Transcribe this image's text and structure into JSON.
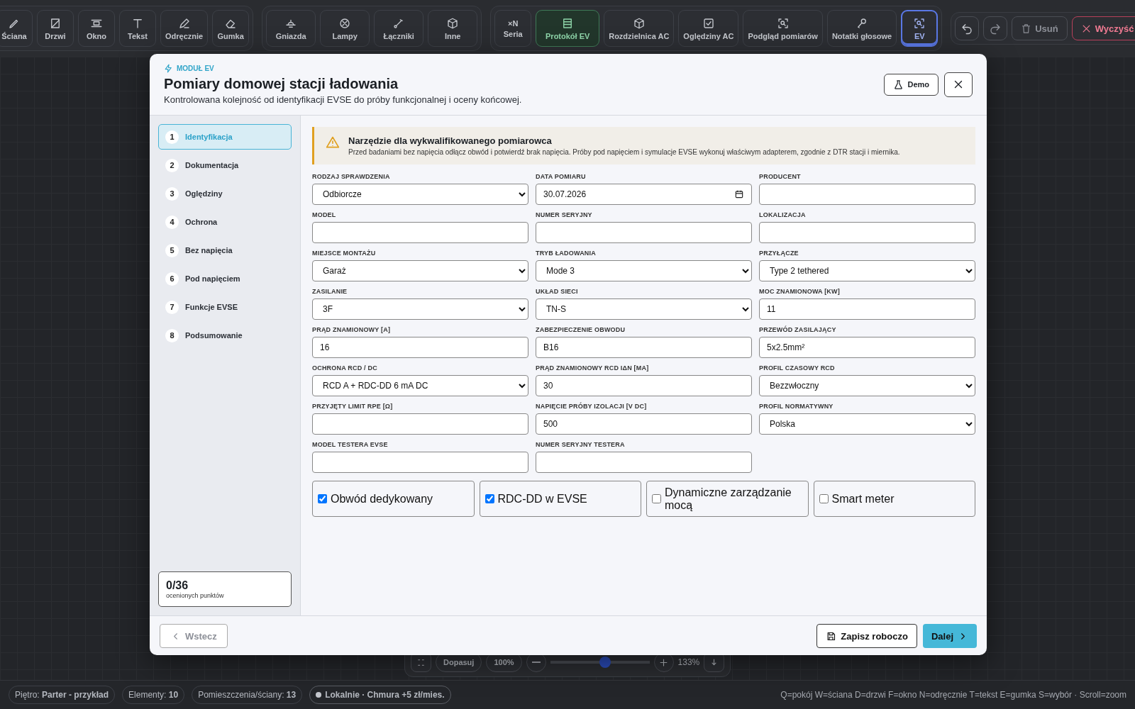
{
  "toolbar": {
    "groups": [
      {
        "buttons": [
          {
            "label": "Ściana"
          },
          {
            "label": "Drzwi"
          },
          {
            "label": "Okno"
          },
          {
            "label": "Tekst"
          },
          {
            "label": "Odręcznie"
          },
          {
            "label": "Gumka"
          }
        ]
      },
      {
        "buttons": [
          {
            "label": "Gniazda"
          },
          {
            "label": "Lampy"
          },
          {
            "label": "Łączniki"
          },
          {
            "label": "Inne"
          }
        ]
      },
      {
        "buttons": [
          {
            "label": "Seria",
            "badge": "×N",
            "selected": false,
            "highlighted": false
          },
          {
            "label": "Protokół EV",
            "selected": false,
            "highlighted": true
          },
          {
            "label": "Rozdzielnica AC",
            "selected": false,
            "highlighted": false
          },
          {
            "label": "Oględziny AC",
            "selected": false,
            "highlighted": false
          },
          {
            "label": "Podgląd pomiarów",
            "selected": false,
            "highlighted": false
          },
          {
            "label": "Notatki głosowe",
            "selected": false,
            "highlighted": false
          },
          {
            "label": "EV",
            "selected": true,
            "highlighted": false
          }
        ]
      }
    ],
    "undo": {
      "disabled": false
    },
    "redo": {
      "disabled": true
    },
    "delete": {
      "label": "Usuń",
      "disabled": true
    },
    "clear": {
      "label": "Wyczyść"
    }
  },
  "zoom_bar": {
    "fit": "Dopasuj",
    "preset": "100%",
    "level": 0.55,
    "reading": "133%"
  },
  "status_bar": {
    "items": [
      {
        "label": "Piętro:",
        "value": "Parter - przykład"
      },
      {
        "label": "Elementy:",
        "value": "10"
      },
      {
        "label": "Pomieszczenia/ściany:",
        "value": "13"
      }
    ],
    "storage": "Lokalnie · Chmura +5 zł/mies.",
    "shortcuts": "Q=pokój W=ściana D=drzwi F=okno N=odręcznie T=tekst E=gumka S=wybór · Scroll=zoom"
  },
  "dialog": {
    "module": "MODUŁ EV",
    "title": "Pomiary domowej stacji ładowania",
    "subtitle": "Kontrolowana kolejność od identyfikacji EVSE do próby funkcjonalnej i oceny końcowej.",
    "demo": "Demo",
    "steps": [
      {
        "number": "1",
        "label": "Identyfikacja",
        "selected": true
      },
      {
        "number": "2",
        "label": "Dokumentacja",
        "selected": false
      },
      {
        "number": "3",
        "label": "Oględziny",
        "selected": false
      },
      {
        "number": "4",
        "label": "Ochrona",
        "selected": false
      },
      {
        "number": "5",
        "label": "Bez napięcia",
        "selected": false
      },
      {
        "number": "6",
        "label": "Pod napięciem",
        "selected": false
      },
      {
        "number": "7",
        "label": "Funkcje EVSE",
        "selected": false
      },
      {
        "number": "8",
        "label": "Podsumowanie",
        "selected": false
      }
    ],
    "progress": {
      "count": "0/36",
      "caption": "ocenionych punktów"
    },
    "alert": {
      "title": "Narzędzie dla wykwalifikowanego pomiarowca",
      "text": "Przed badaniami bez napięcia odłącz obwód i potwierdź brak napięcia. Próby pod napięciem i symulacje EVSE wykonuj właściwym adapterem, zgodnie z DTR stacji i miernika."
    },
    "fields": [
      {
        "label": "RODZAJ SPRAWDZENIA",
        "kind": "select",
        "value": "Odbiorcze"
      },
      {
        "label": "DATA POMIARU",
        "kind": "date",
        "value": "30.07.2026"
      },
      {
        "label": "PRODUCENT",
        "kind": "input"
      },
      {
        "label": "MODEL",
        "kind": "input"
      },
      {
        "label": "NUMER SERYJNY",
        "kind": "input"
      },
      {
        "label": "LOKALIZACJA",
        "kind": "input"
      },
      {
        "label": "MIEJSCE MONTAŻU",
        "kind": "select",
        "value": "Garaż"
      },
      {
        "label": "TRYB ŁADOWANIA",
        "kind": "select",
        "value": "Mode 3"
      },
      {
        "label": "PRZYŁĄCZE",
        "kind": "select",
        "value": "Type 2 tethered"
      },
      {
        "label": "ZASILANIE",
        "kind": "select",
        "value": "3F"
      },
      {
        "label": "UKŁAD SIECI",
        "kind": "select",
        "value": "TN-S"
      },
      {
        "label": "MOC ZNAMIONOWA [KW]",
        "kind": "input",
        "value": "11"
      },
      {
        "label": "PRĄD ZNAMIONOWY [A]",
        "kind": "input",
        "value": "16"
      },
      {
        "label": "ZABEZPIECZENIE OBWODU",
        "kind": "input",
        "value": "B16"
      },
      {
        "label": "PRZEWÓD ZASILAJĄCY",
        "kind": "input",
        "value": "5x2.5mm²"
      },
      {
        "label": "OCHRONA RCD / DC",
        "kind": "select",
        "value": "RCD A + RDC-DD 6 mA DC"
      },
      {
        "label": "PRĄD ZNAMIONOWY RCD IΔN [MA]",
        "kind": "input",
        "value": "30"
      },
      {
        "label": "PROFIL CZASOWY RCD",
        "kind": "select",
        "value": "Bezzwłoczny"
      },
      {
        "label": "PRZYJĘTY LIMIT RPE [Ω]",
        "kind": "input"
      },
      {
        "label": "NAPIĘCIE PRÓBY IZOLACJI [V DC]",
        "kind": "input",
        "value": "500"
      },
      {
        "label": "PROFIL NORMATYWNY",
        "kind": "select",
        "value": "Polska"
      },
      {
        "label": "MODEL TESTERA EVSE",
        "kind": "input"
      },
      {
        "label": "NUMER SERYJNY TESTERA",
        "kind": "input"
      }
    ],
    "checkboxes": [
      {
        "label": "Obwód dedykowany",
        "checked": true
      },
      {
        "label": "RDC-DD w EVSE",
        "checked": true
      },
      {
        "label": "Dynamiczne zarządzanie mocą",
        "checked": false
      },
      {
        "label": "Smart meter",
        "checked": false
      }
    ],
    "back": {
      "label": "Wstecz",
      "disabled": true
    },
    "save": "Zapisz roboczo",
    "next": "Dalej"
  }
}
